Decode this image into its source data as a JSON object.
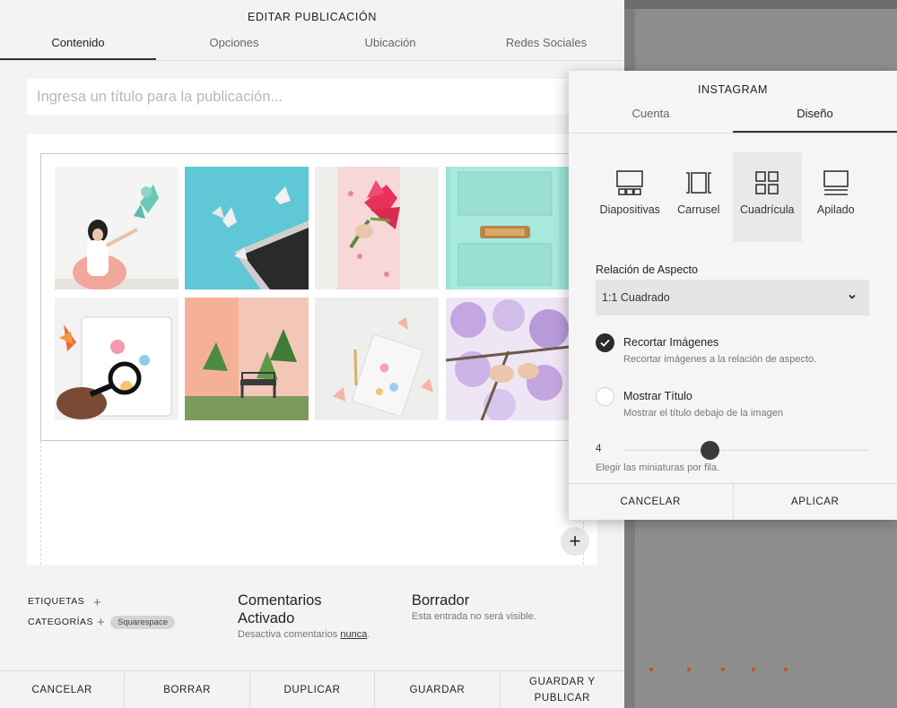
{
  "editor": {
    "title": "EDITAR PUBLICACIÓN",
    "tabs": [
      {
        "label": "Contenido",
        "active": true
      },
      {
        "label": "Opciones"
      },
      {
        "label": "Ubicación"
      },
      {
        "label": "Redes Sociales"
      }
    ],
    "title_placeholder": "Ingresa un título para la publicación...",
    "meta": {
      "tags_label": "ETIQUETAS",
      "categories_label": "CATEGORÍAS",
      "category_tag": "Squarespace",
      "comments_heading_line1": "Comentarios",
      "comments_heading_line2": "Activado",
      "comments_desc": "Desactiva comentarios",
      "comments_link": "nunca",
      "comments_period": ".",
      "status_heading": "Borrador",
      "status_desc": "Esta entrada no será visible."
    },
    "footer": {
      "cancel": "CANCELAR",
      "delete": "BORRAR",
      "duplicate": "DUPLICAR",
      "save": "GUARDAR",
      "save_publish_line1": "GUARDAR Y",
      "save_publish_line2": "PUBLICAR"
    },
    "add_icon": "+"
  },
  "instagram_panel": {
    "title": "INSTAGRAM",
    "tabs": [
      {
        "label": "Cuenta"
      },
      {
        "label": "Diseño",
        "active": true
      }
    ],
    "layouts": [
      {
        "label": "Diapositivas",
        "icon": "slideshow-icon"
      },
      {
        "label": "Carrusel",
        "icon": "carousel-icon"
      },
      {
        "label": "Cuadrícula",
        "icon": "grid-icon",
        "active": true
      },
      {
        "label": "Apilado",
        "icon": "stacked-icon"
      }
    ],
    "aspect_label": "Relación de Aspecto",
    "aspect_value": "1:1 Cuadrado",
    "crop_title": "Recortar Imágenes",
    "crop_desc": "Recortar imágenes a la relación de aspecto.",
    "crop_checked": true,
    "show_title_title": "Mostrar Título",
    "show_title_desc": "Mostrar el título debajo de la imagen",
    "show_title_checked": false,
    "thumbs_value": "4",
    "thumbs_hint": "Elegir las miniaturas por fila.",
    "cancel": "CANCELAR",
    "apply": "APLICAR"
  },
  "colors": {
    "accent_dark": "#2b2b2b",
    "background": "#f3f3f3",
    "dots": "#c0502a"
  }
}
